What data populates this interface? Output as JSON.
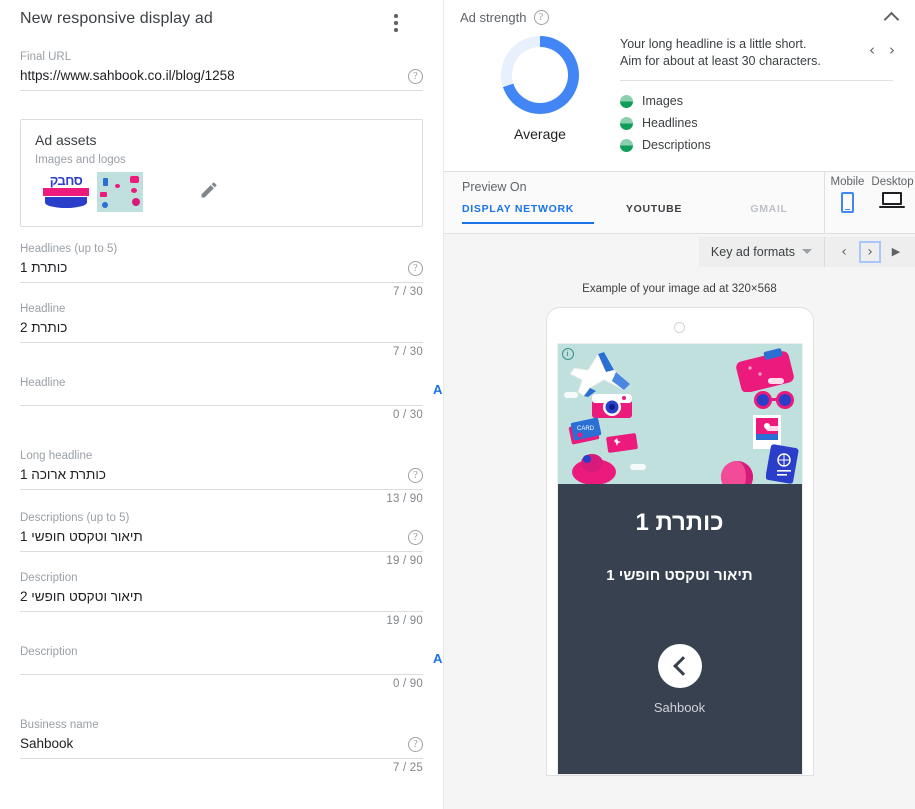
{
  "left": {
    "title": "New responsive display ad",
    "menu_icon": "more-vert-icon",
    "final_url": {
      "label": "Final URL",
      "value": "https://www.sahbook.co.il/blog/1258"
    },
    "assets": {
      "title": "Ad assets",
      "subtitle": "Images and logos",
      "logo_text": "סחבק",
      "edit_icon": "pencil-icon"
    },
    "headlines": {
      "group_label": "Headlines (up to 5)",
      "items": [
        {
          "label": "Headlines (up to 5)",
          "value": "כותרת 1",
          "counter": "7 / 30",
          "has_help": true
        },
        {
          "label": "Headline",
          "value": "כותרת 2",
          "counter": "7 / 30",
          "has_help": false
        },
        {
          "label": "Headline",
          "value": "",
          "counter": "0 / 30",
          "has_help": false,
          "add": "ADD"
        }
      ]
    },
    "long_headline": {
      "label": "Long headline",
      "value": "כותרת ארוכה 1",
      "counter": "13 / 90"
    },
    "descriptions": {
      "items": [
        {
          "label": "Descriptions (up to 5)",
          "value": "תיאור וטקסט חופשי 1",
          "counter": "19 / 90",
          "has_help": true
        },
        {
          "label": "Description",
          "value": "תיאור וטקסט חופשי 2",
          "counter": "19 / 90",
          "has_help": false
        },
        {
          "label": "Description",
          "value": "",
          "counter": "0 / 90",
          "has_help": false,
          "add": "ADD"
        }
      ]
    },
    "business_name": {
      "label": "Business name",
      "value": "Sahbook",
      "counter": "7 / 25"
    }
  },
  "ad_strength": {
    "title": "Ad strength",
    "help_icon": "help-circle-icon",
    "collapse_icon": "chevron-up-icon",
    "rating": "Average",
    "donut_percent": 70,
    "donut_color": "#4285f4",
    "donut_track_color": "#e8f0fe",
    "message_line1": "Your long headline is a little short.",
    "message_line2": "Aim for about at least 30 characters.",
    "prev_icon": "chevron-left-icon",
    "next_icon": "chevron-right-icon",
    "checklist": [
      {
        "label": "Images",
        "status_color": "#0f9d58"
      },
      {
        "label": "Headlines",
        "status_color": "#0f9d58"
      },
      {
        "label": "Descriptions",
        "status_color": "#0f9d58"
      }
    ]
  },
  "preview": {
    "header_title": "Preview On",
    "tabs": [
      {
        "label": "DISPLAY NETWORK",
        "state": "active"
      },
      {
        "label": "YOUTUBE",
        "state": "dark"
      },
      {
        "label": "GMAIL",
        "state": "dim"
      }
    ],
    "devices": [
      {
        "label": "Mobile",
        "icon": "mobile-icon",
        "selected": true
      },
      {
        "label": "Desktop",
        "icon": "desktop-icon",
        "selected": false
      }
    ],
    "format_select": "Key ad formats",
    "format_caret_icon": "chevron-down-icon",
    "nav_prev_icon": "chevron-left-icon",
    "nav_next_icon": "chevron-right-icon",
    "nav_play_icon": "play-icon",
    "caption": "Example of your image ad at 320×568",
    "adchoices_icon": "adchoices-icon",
    "ad": {
      "headline": "כותרת 1",
      "description": "תיאור וטקסט חופשי 1",
      "cta_icon": "chevron-left-icon",
      "business": "Sahbook",
      "background_color": "#37414f",
      "image_background_color": "#bfe0dd"
    }
  }
}
